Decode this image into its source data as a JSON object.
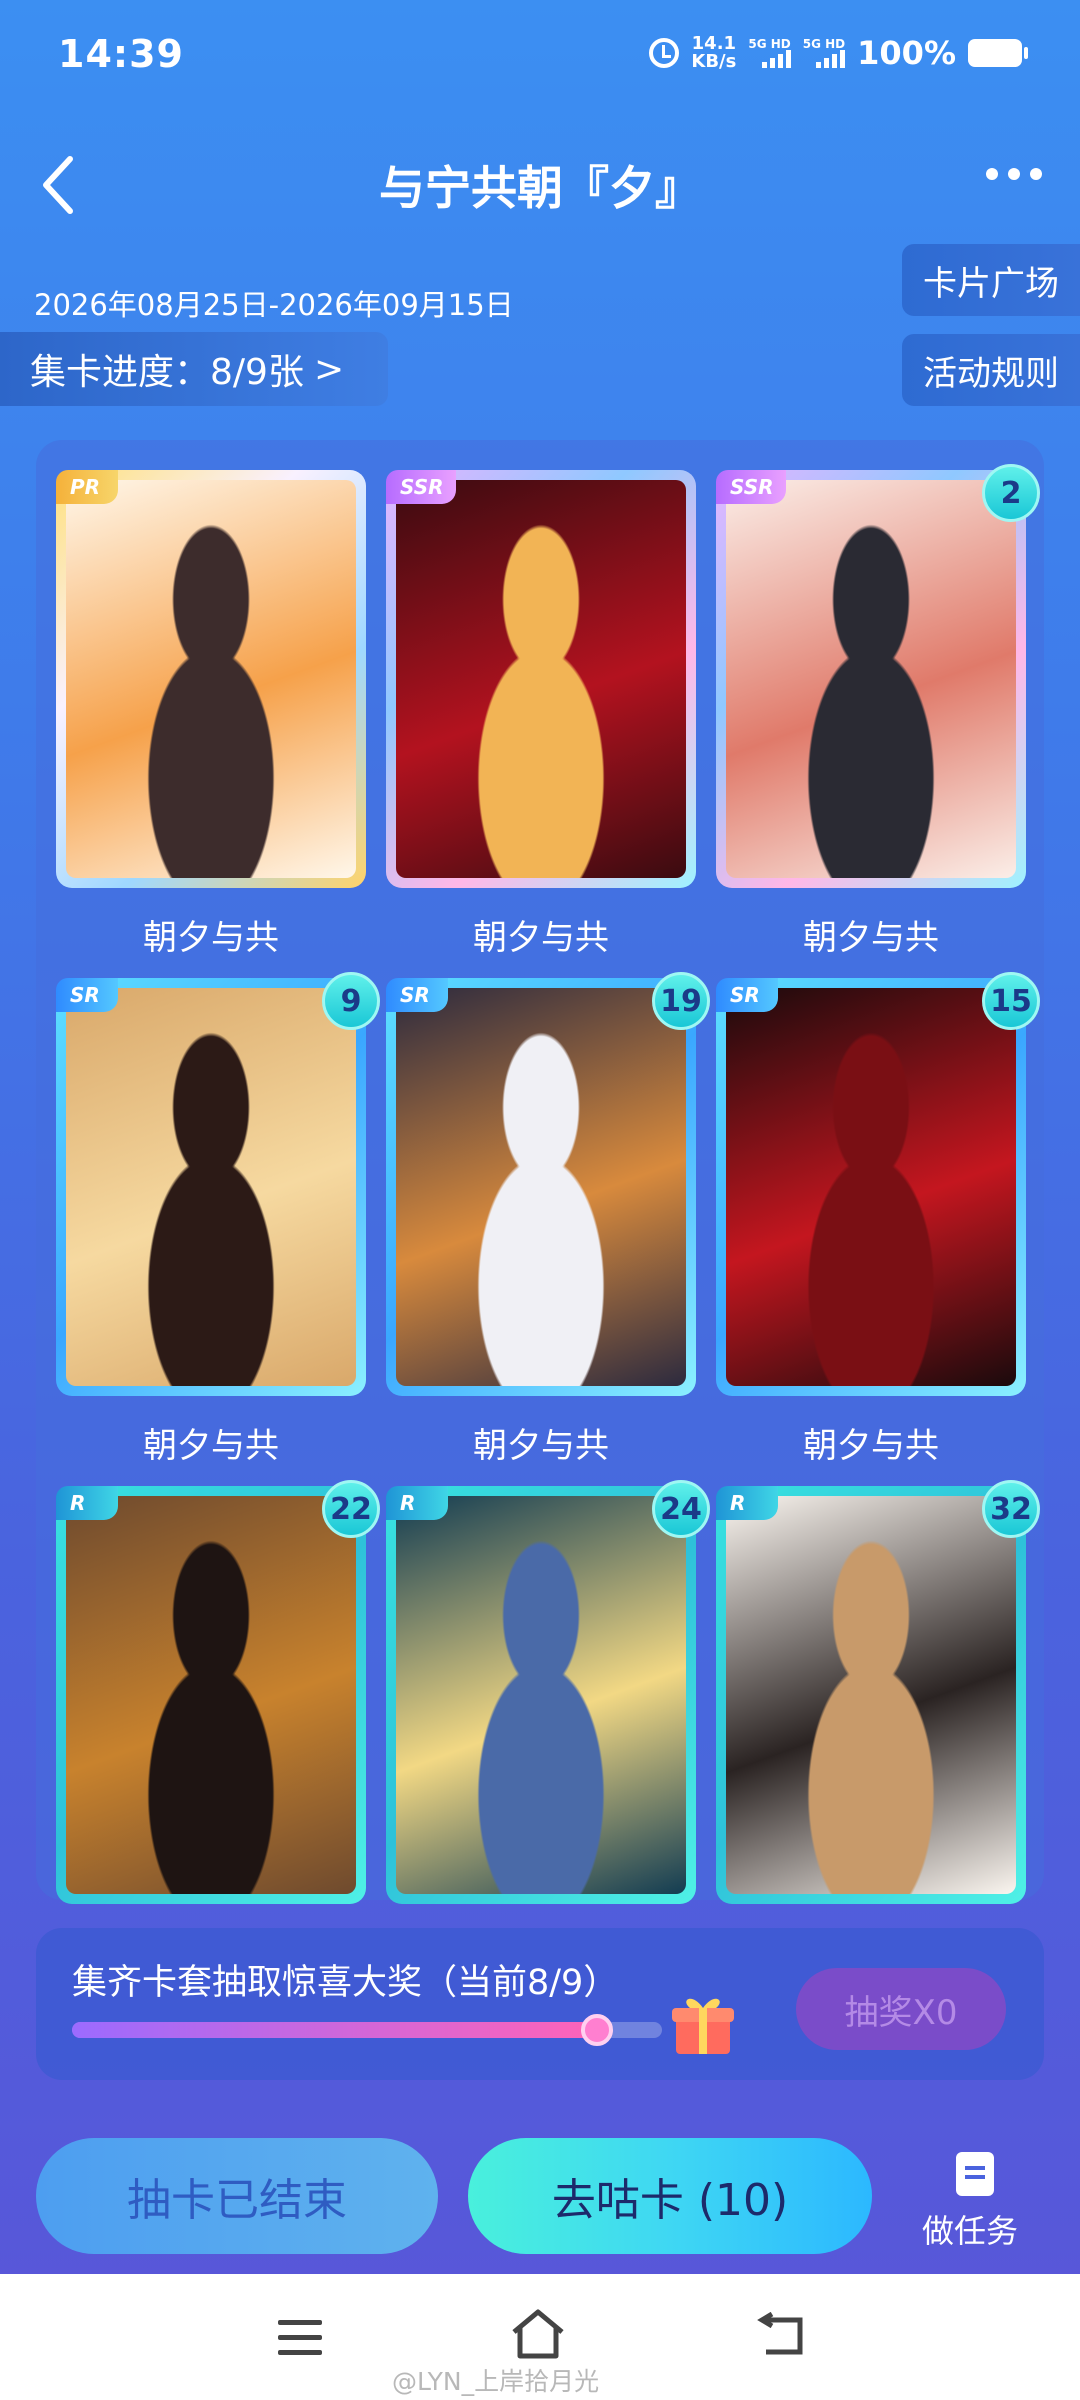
{
  "status_bar": {
    "time": "14:39",
    "net_speed_value": "14.1",
    "net_speed_unit": "KB/s",
    "sim1_label": "5G HD",
    "sim2_label": "5G HD",
    "battery": "100%",
    "icons": [
      "alarm-icon",
      "signal-icon",
      "battery-icon"
    ]
  },
  "header": {
    "title": "与宁共朝『夕』",
    "back_icon": "chevron-left-icon",
    "more_icon": "more-icon"
  },
  "event": {
    "date_range": "2026年08月25日-2026年09月15日",
    "progress_label": "集卡进度：8/9张",
    "progress_chevron": ">",
    "plaza_button": "卡片广场",
    "rules_button": "活动规则"
  },
  "cards": [
    {
      "rarity": "PR",
      "name": "朝夕与共",
      "count": "",
      "palette": [
        "#fff7ea",
        "#f6a14a",
        "#3d2c2c"
      ]
    },
    {
      "rarity": "SSR",
      "name": "朝夕与共",
      "count": "",
      "palette": [
        "#3a0b10",
        "#b3121f",
        "#f2b455"
      ]
    },
    {
      "rarity": "SSR",
      "name": "朝夕与共",
      "count": "2",
      "palette": [
        "#fbeee8",
        "#e07a6a",
        "#2a2a33"
      ]
    },
    {
      "rarity": "SR",
      "name": "朝夕与共",
      "count": "9",
      "palette": [
        "#d9a86a",
        "#f6d9a0",
        "#2c1a16"
      ]
    },
    {
      "rarity": "SR",
      "name": "朝夕与共",
      "count": "19",
      "palette": [
        "#2c2a3e",
        "#d88a3d",
        "#f0f0f5"
      ]
    },
    {
      "rarity": "SR",
      "name": "朝夕与共",
      "count": "15",
      "palette": [
        "#1a0a0c",
        "#c4161f",
        "#7a0f14"
      ]
    },
    {
      "rarity": "R",
      "name": "",
      "count": "22",
      "palette": [
        "#6e4a2e",
        "#c8822d",
        "#1e1412"
      ]
    },
    {
      "rarity": "R",
      "name": "",
      "count": "24",
      "palette": [
        "#123c52",
        "#f2d884",
        "#4a6aa8"
      ]
    },
    {
      "rarity": "R",
      "name": "",
      "count": "32",
      "palette": [
        "#fbf6f0",
        "#2a2322",
        "#c89a6a"
      ]
    }
  ],
  "prize": {
    "text": "集齐卡套抽取惊喜大奖（当前8/9）",
    "progress": 0.889,
    "gift_icon": "gift-icon",
    "lottery_button": "抽奖X0"
  },
  "actions": {
    "ended_button": "抽卡已结束",
    "draw_button": "去咕卡 (10)",
    "task_label": "做任务",
    "task_icon": "document-icon"
  },
  "nav": {
    "icons": [
      "menu-icon",
      "home-icon",
      "back-icon"
    ],
    "watermark": "@LYN_上岸拾月光"
  }
}
